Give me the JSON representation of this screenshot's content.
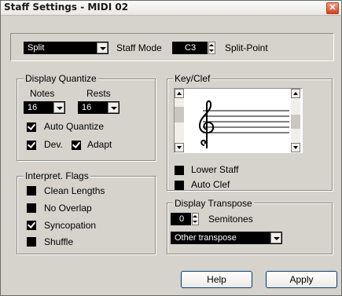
{
  "window": {
    "title": "Staff Settings - MIDI 02"
  },
  "topbar": {
    "staff_mode_value": "Split",
    "staff_mode_label": "Staff Mode",
    "split_point_value": "C3",
    "split_point_label": "Split-Point"
  },
  "display_quantize": {
    "title": "Display Quantize",
    "notes_label": "Notes",
    "rests_label": "Rests",
    "notes_value": "16",
    "rests_value": "16",
    "auto_quantize": {
      "label": "Auto Quantize",
      "checked": true
    },
    "dev": {
      "label": "Dev.",
      "checked": true
    },
    "adapt": {
      "label": "Adapt",
      "checked": true
    }
  },
  "key_clef": {
    "title": "Key/Clef",
    "lower_staff": {
      "label": "Lower Staff",
      "checked": false
    },
    "auto_clef": {
      "label": "Auto Clef",
      "checked": false
    }
  },
  "interpret_flags": {
    "title": "Interpret. Flags",
    "items": [
      {
        "label": "Clean Lengths",
        "checked": false
      },
      {
        "label": "No Overlap",
        "checked": false
      },
      {
        "label": "Syncopation",
        "checked": true
      },
      {
        "label": "Shuffle",
        "checked": false
      }
    ]
  },
  "display_transpose": {
    "title": "Display Transpose",
    "semitones_value": "0",
    "semitones_label": "Semitones",
    "preset_value": "Other transpose"
  },
  "buttons": {
    "help": "Help",
    "apply": "Apply"
  }
}
